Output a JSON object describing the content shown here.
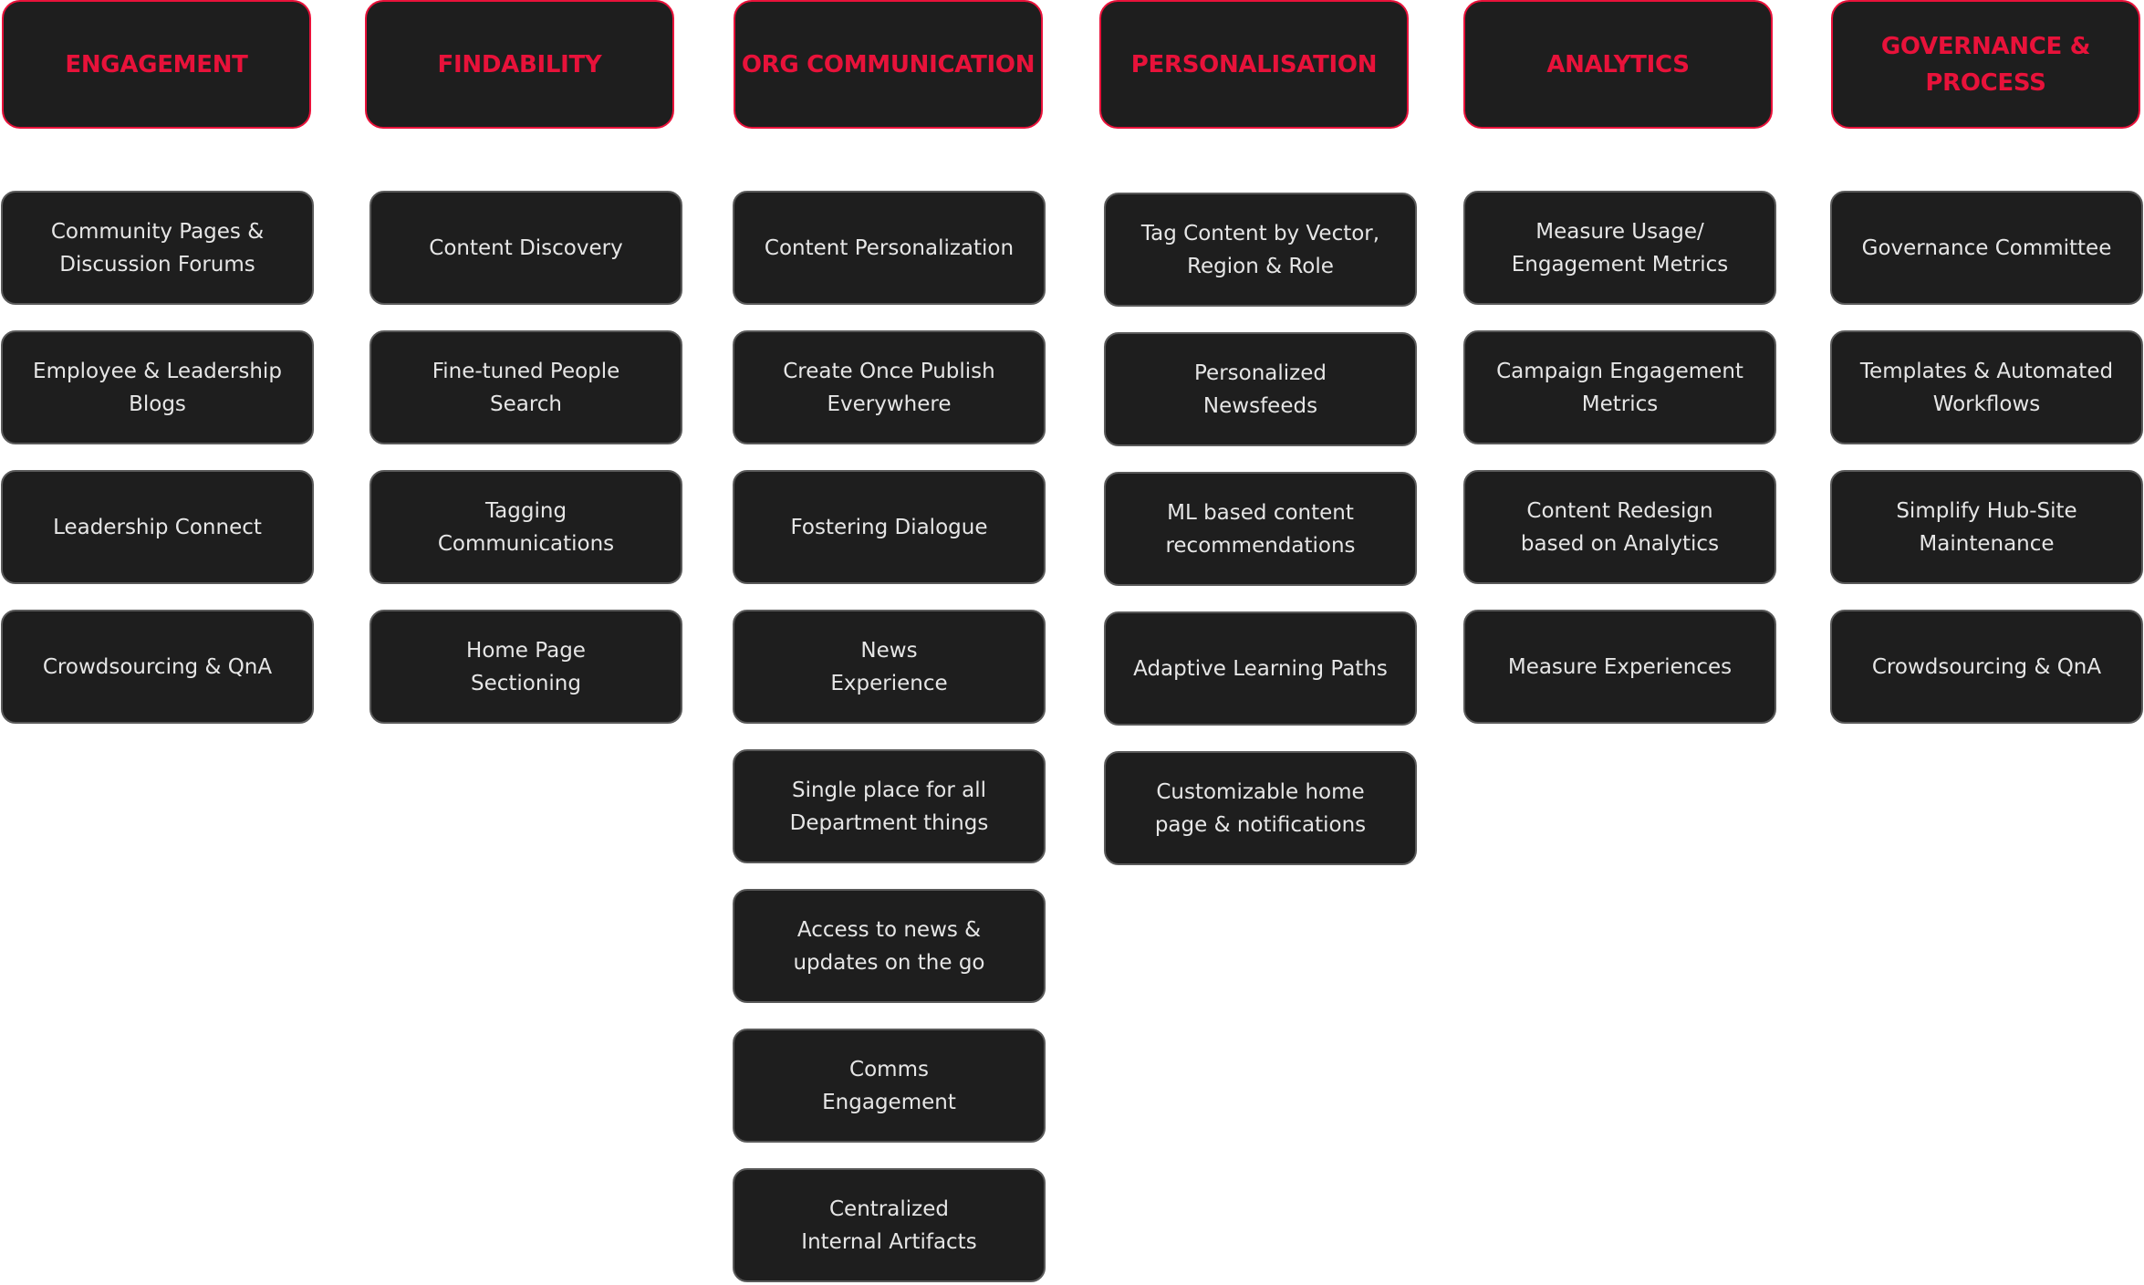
{
  "columns": [
    {
      "title": "ENGAGEMENT",
      "items": [
        "Community Pages &\nDiscussion Forums",
        "Employee & Leadership\nBlogs",
        "Leadership Connect",
        "Crowdsourcing & QnA"
      ]
    },
    {
      "title": "FINDABILITY",
      "items": [
        "Content Discovery",
        "Fine-tuned People\nSearch",
        "Tagging\nCommunications",
        "Home Page\nSectioning"
      ]
    },
    {
      "title": "ORG COMMUNICATION",
      "items": [
        "Content Personalization",
        "Create Once Publish\nEverywhere",
        "Fostering Dialogue",
        "News\nExperience",
        "Single place for all\nDepartment things",
        "Access to news &\nupdates on the go",
        "Comms\nEngagement",
        "Centralized\nInternal Artifacts"
      ]
    },
    {
      "title": "PERSONALISATION",
      "items": [
        "Tag Content by Vector,\nRegion & Role",
        "Personalized\nNewsfeeds",
        "ML based content\nrecommendations",
        "Adaptive Learning Paths",
        "Customizable home\npage & notifications"
      ]
    },
    {
      "title": "ANALYTICS",
      "items": [
        "Measure Usage/\nEngagement Metrics",
        "Campaign Engagement\nMetrics",
        "Content Redesign\nbased on Analytics",
        "Measure Experiences"
      ]
    },
    {
      "title": "GOVERNANCE &\nPROCESS",
      "items": [
        "Governance Committee",
        "Templates & Automated\nWorkflows",
        "Simplify Hub-Site\nMaintenance",
        "Crowdsourcing & QnA"
      ]
    }
  ],
  "colors": {
    "accent": "#e8123a",
    "card_bg": "#1e1e1e",
    "card_border": "#5a5a5a",
    "card_text": "#e6e6e6"
  }
}
